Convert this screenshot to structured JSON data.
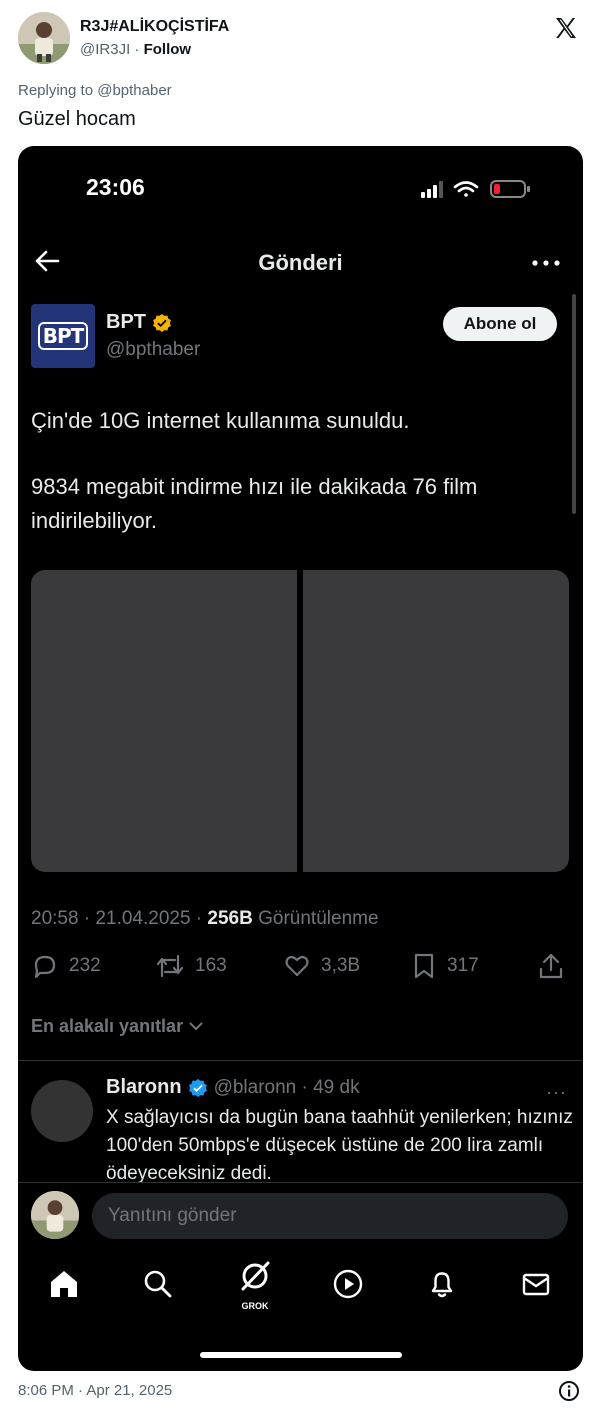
{
  "embed": {
    "author_name": "R3J#ALİKOÇİSTİFA",
    "author_handle": "@IR3JI",
    "separator": "·",
    "follow_label": "Follow",
    "replying_to": "Replying to @bpthaber",
    "text": "Güzel hocam",
    "timestamp": "8:06 PM · Apr 21, 2025"
  },
  "phone": {
    "status_time": "23:06",
    "nav_title": "Gönderi",
    "post": {
      "logo_text": "BPT",
      "author_name": "BPT",
      "author_handle": "@bpthaber",
      "follow_label": "Abone ol",
      "paragraph1": "Çin'de 10G internet kullanıma sunuldu.",
      "paragraph2": "9834 megabit indirme hızı ile dakikada 76 film indirilebiliyor.",
      "date": "20:58 · 21.04.2025 · ",
      "views_count": "256B",
      "views_label": " Görüntülenme",
      "replies": "232",
      "reposts": "163",
      "likes": "3,3B",
      "bookmarks": "317"
    },
    "sort_label": "En alakalı yanıtlar",
    "reply": {
      "name": "Blaronn",
      "meta": "@blaronn · 49 dk",
      "more": "···",
      "text": "X sağlayıcısı da bugün bana taahhüt yenilerken; hızınız 100'den 50mbps'e düşecek üstüne de 200 lira zamlı ödeyeceksiniz dedi."
    },
    "compose_placeholder": "Yanıtını gönder",
    "tabs": {
      "grok_label": "GROK"
    }
  },
  "colors": {
    "verified_gold": "#f4b400",
    "verified_blue": "#1d9bf0",
    "battery_red": "#f4212e"
  }
}
